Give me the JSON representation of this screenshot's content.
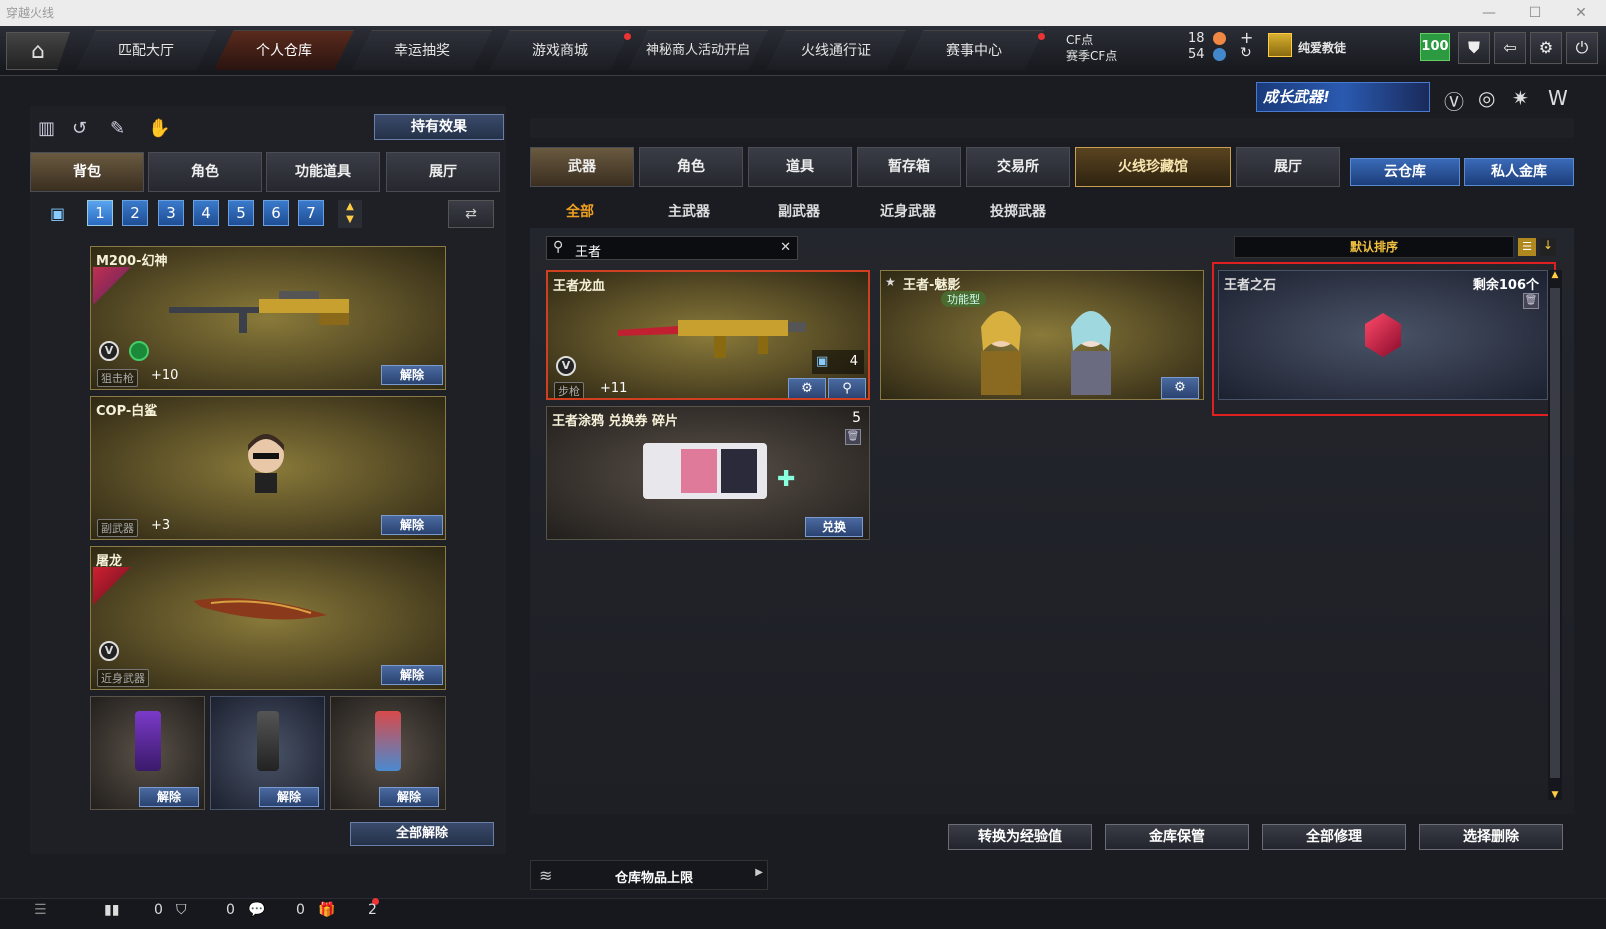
{
  "window": {
    "title": "穿越火线",
    "minimize": "—",
    "maximize": "☐",
    "close": "✕"
  },
  "nav": {
    "home_icon": "home-icon",
    "tabs": [
      {
        "label": "匹配大厅"
      },
      {
        "label": "个人仓库"
      },
      {
        "label": "幸运抽奖"
      },
      {
        "label": "游戏商城"
      },
      {
        "label": "神秘商人活动开启"
      },
      {
        "label": "火线通行证"
      },
      {
        "label": "赛事中心"
      }
    ]
  },
  "currency": {
    "cf_label": "CF点",
    "cf_value": "18",
    "season_label": "赛季CF点",
    "season_value": "54",
    "plus": "+",
    "refresh": "↻"
  },
  "user": {
    "name": "纯爱教徒",
    "level": "100",
    "icon": "clan-badge-icon"
  },
  "top_icons": [
    "shield-icon",
    "exit-icon",
    "settings-icon",
    "power-icon"
  ],
  "banner": {
    "text": "成长武器!"
  },
  "left": {
    "effect_button": "持有效果",
    "tabs": [
      "背包",
      "角色",
      "功能道具",
      "展厅"
    ],
    "slots": [
      "1",
      "2",
      "3",
      "4",
      "5",
      "6",
      "7"
    ],
    "items": [
      {
        "name": "M200-幻神",
        "type": "狙击枪",
        "level": "+10",
        "action": "解除"
      },
      {
        "name": "COP-白鲨",
        "type": "副武器",
        "level": "+3",
        "action": "解除"
      },
      {
        "name": "屠龙",
        "type": "近身武器",
        "level": "",
        "action": "解除"
      }
    ],
    "grenades": [
      {
        "action": "解除"
      },
      {
        "action": "解除"
      },
      {
        "action": "解除"
      }
    ],
    "unbind_all": "全部解除"
  },
  "right": {
    "tabs": [
      "武器",
      "角色",
      "道具",
      "暂存箱",
      "交易所",
      "火线珍藏馆",
      "展厅"
    ],
    "extra_tabs": [
      "云仓库",
      "私人金库"
    ],
    "subtabs": [
      "全部",
      "主武器",
      "副武器",
      "近身武器",
      "投掷武器"
    ],
    "search": {
      "value": "王者",
      "clear": "✕"
    },
    "sort": {
      "label": "默认排序"
    },
    "items": [
      {
        "name": "王者龙血",
        "type": "步枪",
        "level": "+11",
        "count": "4"
      },
      {
        "name": "王者-魅影",
        "tag": "功能型"
      },
      {
        "name": "王者之石",
        "remaining": "剩余106个"
      },
      {
        "name": "王者涂鸦 兑换券 碎片",
        "count": "5",
        "action": "兑换"
      }
    ],
    "buttons": [
      "转换为经验值",
      "金库保管",
      "全部修理",
      "选择删除"
    ],
    "limit": "仓库物品上限"
  },
  "statusbar": {
    "v1": "0",
    "v2": "0",
    "v3": "0",
    "v4": "2"
  }
}
